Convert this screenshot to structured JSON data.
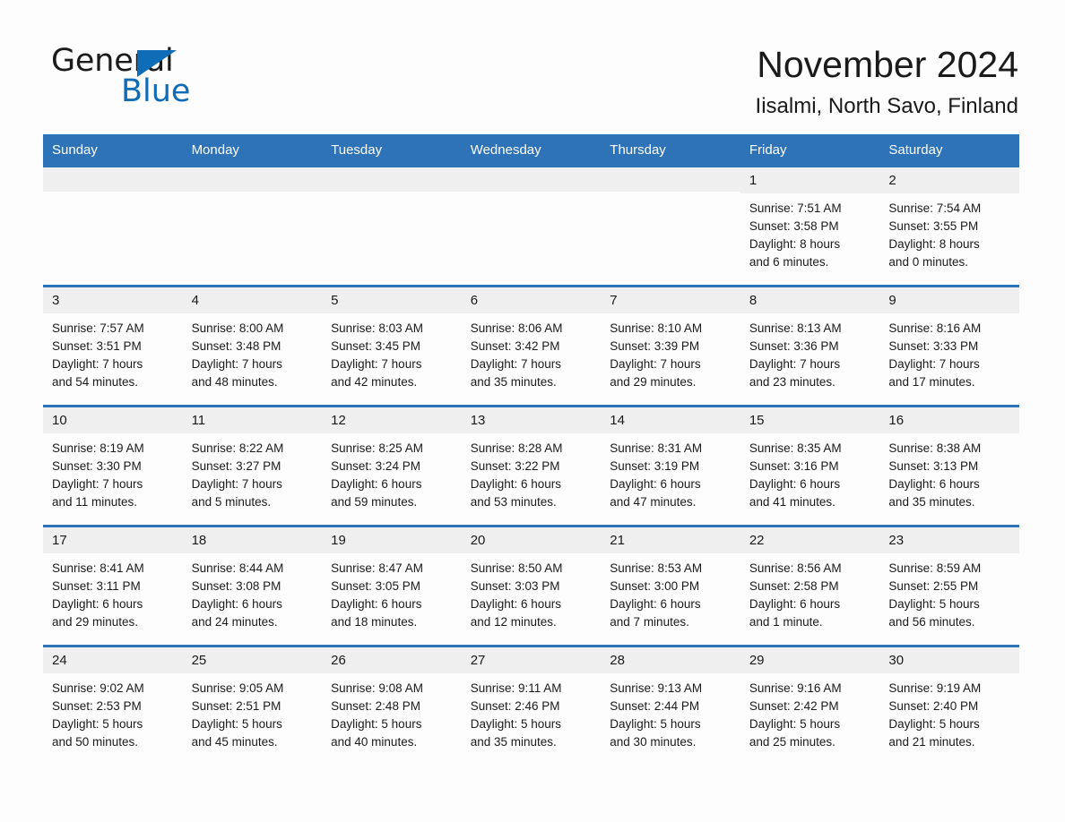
{
  "logo": {
    "word_one": "General",
    "word_two": "Blue",
    "accent_color": "#0f6cb6",
    "triangle_icon": "triangle-icon"
  },
  "header": {
    "month_title": "November 2024",
    "location": "Iisalmi, North Savo, Finland"
  },
  "theme": {
    "header_blue": "#2e72b8",
    "daynum_band": "#efefef",
    "page_background": "#fdfdfd",
    "text": "#1a1a1a"
  },
  "calendar": {
    "weekday_headers": [
      "Sunday",
      "Monday",
      "Tuesday",
      "Wednesday",
      "Thursday",
      "Friday",
      "Saturday"
    ],
    "weeks": [
      [
        {
          "day": "",
          "empty": true
        },
        {
          "day": "",
          "empty": true
        },
        {
          "day": "",
          "empty": true
        },
        {
          "day": "",
          "empty": true
        },
        {
          "day": "",
          "empty": true
        },
        {
          "day": "1",
          "sunrise": "Sunrise: 7:51 AM",
          "sunset": "Sunset: 3:58 PM",
          "daylight_line1": "Daylight: 8 hours",
          "daylight_line2": "and 6 minutes."
        },
        {
          "day": "2",
          "sunrise": "Sunrise: 7:54 AM",
          "sunset": "Sunset: 3:55 PM",
          "daylight_line1": "Daylight: 8 hours",
          "daylight_line2": "and 0 minutes."
        }
      ],
      [
        {
          "day": "3",
          "sunrise": "Sunrise: 7:57 AM",
          "sunset": "Sunset: 3:51 PM",
          "daylight_line1": "Daylight: 7 hours",
          "daylight_line2": "and 54 minutes."
        },
        {
          "day": "4",
          "sunrise": "Sunrise: 8:00 AM",
          "sunset": "Sunset: 3:48 PM",
          "daylight_line1": "Daylight: 7 hours",
          "daylight_line2": "and 48 minutes."
        },
        {
          "day": "5",
          "sunrise": "Sunrise: 8:03 AM",
          "sunset": "Sunset: 3:45 PM",
          "daylight_line1": "Daylight: 7 hours",
          "daylight_line2": "and 42 minutes."
        },
        {
          "day": "6",
          "sunrise": "Sunrise: 8:06 AM",
          "sunset": "Sunset: 3:42 PM",
          "daylight_line1": "Daylight: 7 hours",
          "daylight_line2": "and 35 minutes."
        },
        {
          "day": "7",
          "sunrise": "Sunrise: 8:10 AM",
          "sunset": "Sunset: 3:39 PM",
          "daylight_line1": "Daylight: 7 hours",
          "daylight_line2": "and 29 minutes."
        },
        {
          "day": "8",
          "sunrise": "Sunrise: 8:13 AM",
          "sunset": "Sunset: 3:36 PM",
          "daylight_line1": "Daylight: 7 hours",
          "daylight_line2": "and 23 minutes."
        },
        {
          "day": "9",
          "sunrise": "Sunrise: 8:16 AM",
          "sunset": "Sunset: 3:33 PM",
          "daylight_line1": "Daylight: 7 hours",
          "daylight_line2": "and 17 minutes."
        }
      ],
      [
        {
          "day": "10",
          "sunrise": "Sunrise: 8:19 AM",
          "sunset": "Sunset: 3:30 PM",
          "daylight_line1": "Daylight: 7 hours",
          "daylight_line2": "and 11 minutes."
        },
        {
          "day": "11",
          "sunrise": "Sunrise: 8:22 AM",
          "sunset": "Sunset: 3:27 PM",
          "daylight_line1": "Daylight: 7 hours",
          "daylight_line2": "and 5 minutes."
        },
        {
          "day": "12",
          "sunrise": "Sunrise: 8:25 AM",
          "sunset": "Sunset: 3:24 PM",
          "daylight_line1": "Daylight: 6 hours",
          "daylight_line2": "and 59 minutes."
        },
        {
          "day": "13",
          "sunrise": "Sunrise: 8:28 AM",
          "sunset": "Sunset: 3:22 PM",
          "daylight_line1": "Daylight: 6 hours",
          "daylight_line2": "and 53 minutes."
        },
        {
          "day": "14",
          "sunrise": "Sunrise: 8:31 AM",
          "sunset": "Sunset: 3:19 PM",
          "daylight_line1": "Daylight: 6 hours",
          "daylight_line2": "and 47 minutes."
        },
        {
          "day": "15",
          "sunrise": "Sunrise: 8:35 AM",
          "sunset": "Sunset: 3:16 PM",
          "daylight_line1": "Daylight: 6 hours",
          "daylight_line2": "and 41 minutes."
        },
        {
          "day": "16",
          "sunrise": "Sunrise: 8:38 AM",
          "sunset": "Sunset: 3:13 PM",
          "daylight_line1": "Daylight: 6 hours",
          "daylight_line2": "and 35 minutes."
        }
      ],
      [
        {
          "day": "17",
          "sunrise": "Sunrise: 8:41 AM",
          "sunset": "Sunset: 3:11 PM",
          "daylight_line1": "Daylight: 6 hours",
          "daylight_line2": "and 29 minutes."
        },
        {
          "day": "18",
          "sunrise": "Sunrise: 8:44 AM",
          "sunset": "Sunset: 3:08 PM",
          "daylight_line1": "Daylight: 6 hours",
          "daylight_line2": "and 24 minutes."
        },
        {
          "day": "19",
          "sunrise": "Sunrise: 8:47 AM",
          "sunset": "Sunset: 3:05 PM",
          "daylight_line1": "Daylight: 6 hours",
          "daylight_line2": "and 18 minutes."
        },
        {
          "day": "20",
          "sunrise": "Sunrise: 8:50 AM",
          "sunset": "Sunset: 3:03 PM",
          "daylight_line1": "Daylight: 6 hours",
          "daylight_line2": "and 12 minutes."
        },
        {
          "day": "21",
          "sunrise": "Sunrise: 8:53 AM",
          "sunset": "Sunset: 3:00 PM",
          "daylight_line1": "Daylight: 6 hours",
          "daylight_line2": "and 7 minutes."
        },
        {
          "day": "22",
          "sunrise": "Sunrise: 8:56 AM",
          "sunset": "Sunset: 2:58 PM",
          "daylight_line1": "Daylight: 6 hours",
          "daylight_line2": "and 1 minute."
        },
        {
          "day": "23",
          "sunrise": "Sunrise: 8:59 AM",
          "sunset": "Sunset: 2:55 PM",
          "daylight_line1": "Daylight: 5 hours",
          "daylight_line2": "and 56 minutes."
        }
      ],
      [
        {
          "day": "24",
          "sunrise": "Sunrise: 9:02 AM",
          "sunset": "Sunset: 2:53 PM",
          "daylight_line1": "Daylight: 5 hours",
          "daylight_line2": "and 50 minutes."
        },
        {
          "day": "25",
          "sunrise": "Sunrise: 9:05 AM",
          "sunset": "Sunset: 2:51 PM",
          "daylight_line1": "Daylight: 5 hours",
          "daylight_line2": "and 45 minutes."
        },
        {
          "day": "26",
          "sunrise": "Sunrise: 9:08 AM",
          "sunset": "Sunset: 2:48 PM",
          "daylight_line1": "Daylight: 5 hours",
          "daylight_line2": "and 40 minutes."
        },
        {
          "day": "27",
          "sunrise": "Sunrise: 9:11 AM",
          "sunset": "Sunset: 2:46 PM",
          "daylight_line1": "Daylight: 5 hours",
          "daylight_line2": "and 35 minutes."
        },
        {
          "day": "28",
          "sunrise": "Sunrise: 9:13 AM",
          "sunset": "Sunset: 2:44 PM",
          "daylight_line1": "Daylight: 5 hours",
          "daylight_line2": "and 30 minutes."
        },
        {
          "day": "29",
          "sunrise": "Sunrise: 9:16 AM",
          "sunset": "Sunset: 2:42 PM",
          "daylight_line1": "Daylight: 5 hours",
          "daylight_line2": "and 25 minutes."
        },
        {
          "day": "30",
          "sunrise": "Sunrise: 9:19 AM",
          "sunset": "Sunset: 2:40 PM",
          "daylight_line1": "Daylight: 5 hours",
          "daylight_line2": "and 21 minutes."
        }
      ]
    ]
  }
}
